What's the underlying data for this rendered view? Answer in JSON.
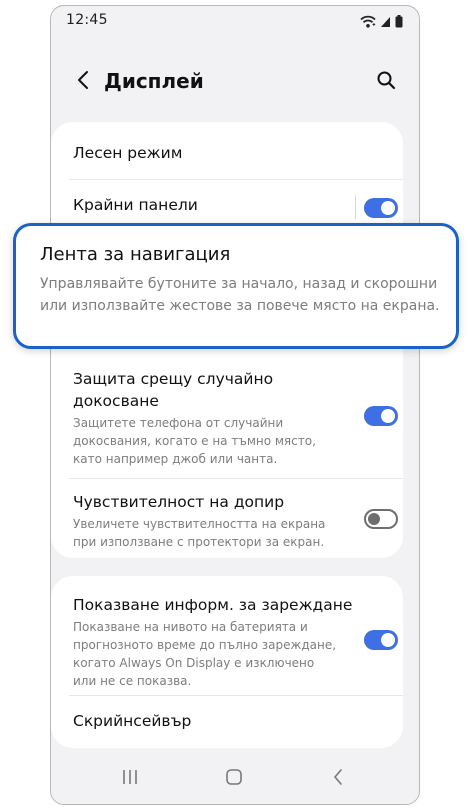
{
  "status_bar": {
    "time": "12:45"
  },
  "header": {
    "title": "Дисплей"
  },
  "settings": {
    "easy_mode": {
      "title": "Лесен режим"
    },
    "edge_panels": {
      "title": "Крайни панели",
      "enabled": true
    },
    "navigation_bar": {
      "title": "Лента за навигация",
      "description": "Управлявайте бутоните за начало, назад и скорошни или използвайте жестове за повече място на екрана."
    },
    "accidental_touch": {
      "title": "Защита срещу случайно докосване",
      "description": "Защитете телефона от случайни докосвания, когато е на тъмно място, като например джоб или чанта.",
      "enabled": true
    },
    "touch_sensitivity": {
      "title": "Чувствителност на допир",
      "description": "Увеличете чувствителността на екрана при използване с протектори за екран.",
      "enabled": false
    },
    "charging_info": {
      "title": "Показване информ. за зареждане",
      "description": "Показване на нивото на батерията и прогнозното време до пълно зареждане, когато Always On Display е изключено или не се показва.",
      "enabled": true
    },
    "screensaver": {
      "title": "Скрийнсейвър"
    }
  },
  "colors": {
    "accent": "#3e6fe3",
    "highlight_border": "#1a62c7",
    "background": "#f2f2f4"
  },
  "icons": {
    "back": "chevron-left-icon",
    "search": "search-icon",
    "wifi": "wifi-icon",
    "battery": "battery-icon",
    "recents": "recents-icon",
    "home": "home-icon",
    "nav_back": "back-icon"
  }
}
